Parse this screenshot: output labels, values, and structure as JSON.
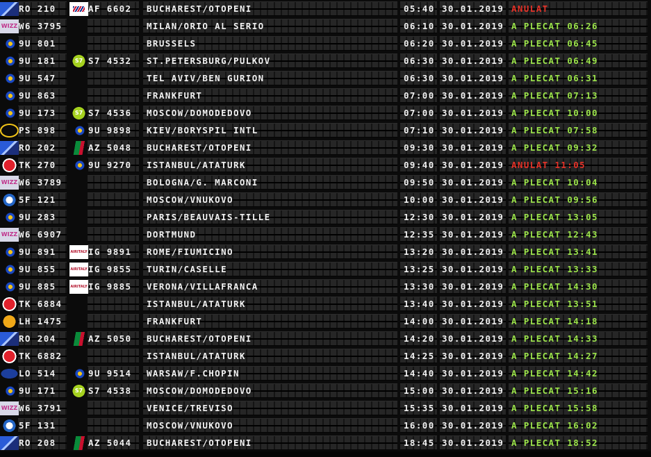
{
  "rows": [
    {
      "flight": "RO 210",
      "logo": "tarom-logo",
      "codeshare_logo": "air-france-logo",
      "codeshare": "AF 6602",
      "destination": "BUCHAREST/OTOPENI",
      "time": "05:40",
      "date": "30.01.2019",
      "status": "ANULAT",
      "status_color": "red"
    },
    {
      "flight": "W6 3795",
      "logo": "wizz-air-logo",
      "codeshare_logo": "",
      "codeshare": "",
      "destination": "MILAN/ORIO AL SERIO",
      "time": "06:10",
      "date": "30.01.2019",
      "status": "A PLECAT 06:26",
      "status_color": "green"
    },
    {
      "flight": "9U 801",
      "logo": "air-moldova-logo",
      "codeshare_logo": "",
      "codeshare": "",
      "destination": "BRUSSELS",
      "time": "06:20",
      "date": "30.01.2019",
      "status": "A PLECAT 06:45",
      "status_color": "green"
    },
    {
      "flight": "9U 181",
      "logo": "air-moldova-logo",
      "codeshare_logo": "s7-logo",
      "codeshare": "S7 4532",
      "destination": "ST.PETERSBURG/PULKOV",
      "time": "06:30",
      "date": "30.01.2019",
      "status": "A PLECAT 06:49",
      "status_color": "green"
    },
    {
      "flight": "9U 547",
      "logo": "air-moldova-logo",
      "codeshare_logo": "",
      "codeshare": "",
      "destination": "TEL AVIV/BEN GURION",
      "time": "06:30",
      "date": "30.01.2019",
      "status": "A PLECAT 06:31",
      "status_color": "green"
    },
    {
      "flight": "9U 863",
      "logo": "air-moldova-logo",
      "codeshare_logo": "",
      "codeshare": "",
      "destination": "FRANKFURT",
      "time": "07:00",
      "date": "30.01.2019",
      "status": "A PLECAT 07:13",
      "status_color": "green"
    },
    {
      "flight": "9U 173",
      "logo": "air-moldova-logo",
      "codeshare_logo": "s7-logo",
      "codeshare": "S7 4536",
      "destination": "MOSCOW/DOMODEDOVO",
      "time": "07:00",
      "date": "30.01.2019",
      "status": "A PLECAT 10:00",
      "status_color": "green"
    },
    {
      "flight": "PS 898",
      "logo": "ukraine-intl-logo",
      "codeshare_logo": "air-moldova-logo",
      "codeshare": "9U 9898",
      "destination": "KIEV/BORYSPIL INTL",
      "time": "07:10",
      "date": "30.01.2019",
      "status": "A PLECAT 07:58",
      "status_color": "green"
    },
    {
      "flight": "RO 202",
      "logo": "tarom-logo",
      "codeshare_logo": "alitalia-logo",
      "codeshare": "AZ 5048",
      "destination": "BUCHAREST/OTOPENI",
      "time": "09:30",
      "date": "30.01.2019",
      "status": "A PLECAT 09:32",
      "status_color": "green"
    },
    {
      "flight": "TK 270",
      "logo": "turkish-airlines-logo",
      "codeshare_logo": "air-moldova-logo",
      "codeshare": "9U 9270",
      "destination": "ISTANBUL/ATATURK",
      "time": "09:40",
      "date": "30.01.2019",
      "status": "ANULAT 11:05",
      "status_color": "red"
    },
    {
      "flight": "W6 3789",
      "logo": "wizz-air-logo",
      "codeshare_logo": "",
      "codeshare": "",
      "destination": "BOLOGNA/G. MARCONI",
      "time": "09:50",
      "date": "30.01.2019",
      "status": "A PLECAT 10:04",
      "status_color": "green"
    },
    {
      "flight": "5F 121",
      "logo": "fly-one-logo",
      "codeshare_logo": "",
      "codeshare": "",
      "destination": "MOSCOW/VNUKOVO",
      "time": "10:00",
      "date": "30.01.2019",
      "status": "A PLECAT 09:56",
      "status_color": "green"
    },
    {
      "flight": "9U 283",
      "logo": "air-moldova-logo",
      "codeshare_logo": "",
      "codeshare": "",
      "destination": "PARIS/BEAUVAIS-TILLE",
      "time": "12:30",
      "date": "30.01.2019",
      "status": "A PLECAT 13:05",
      "status_color": "green"
    },
    {
      "flight": "W6 6907",
      "logo": "wizz-air-logo",
      "codeshare_logo": "",
      "codeshare": "",
      "destination": "DORTMUND",
      "time": "12:35",
      "date": "30.01.2019",
      "status": "A PLECAT 12:43",
      "status_color": "green"
    },
    {
      "flight": "9U 891",
      "logo": "air-moldova-logo",
      "codeshare_logo": "air-italy-logo",
      "codeshare": "IG 9891",
      "destination": "ROME/FIUMICINO",
      "time": "13:20",
      "date": "30.01.2019",
      "status": "A PLECAT 13:41",
      "status_color": "green"
    },
    {
      "flight": "9U 855",
      "logo": "air-moldova-logo",
      "codeshare_logo": "air-italy-logo",
      "codeshare": "IG 9855",
      "destination": "TURIN/CASELLE",
      "time": "13:25",
      "date": "30.01.2019",
      "status": "A PLECAT 13:33",
      "status_color": "green"
    },
    {
      "flight": "9U 885",
      "logo": "air-moldova-logo",
      "codeshare_logo": "air-italy-logo",
      "codeshare": "IG 9885",
      "destination": "VERONA/VILLAFRANCA",
      "time": "13:30",
      "date": "30.01.2019",
      "status": "A PLECAT 14:30",
      "status_color": "green"
    },
    {
      "flight": "TK 6884",
      "logo": "turkish-airlines-logo",
      "codeshare_logo": "",
      "codeshare": "",
      "destination": "ISTANBUL/ATATURK",
      "time": "13:40",
      "date": "30.01.2019",
      "status": "A PLECAT 13:51",
      "status_color": "green"
    },
    {
      "flight": "LH 1475",
      "logo": "lufthansa-logo",
      "codeshare_logo": "",
      "codeshare": "",
      "destination": "FRANKFURT",
      "time": "14:00",
      "date": "30.01.2019",
      "status": "A PLECAT 14:18",
      "status_color": "green"
    },
    {
      "flight": "RO 204",
      "logo": "tarom-logo",
      "codeshare_logo": "alitalia-logo",
      "codeshare": "AZ 5050",
      "destination": "BUCHAREST/OTOPENI",
      "time": "14:20",
      "date": "30.01.2019",
      "status": "A PLECAT 14:33",
      "status_color": "green"
    },
    {
      "flight": "TK 6882",
      "logo": "turkish-airlines-logo",
      "codeshare_logo": "",
      "codeshare": "",
      "destination": "ISTANBUL/ATATURK",
      "time": "14:25",
      "date": "30.01.2019",
      "status": "A PLECAT 14:27",
      "status_color": "green"
    },
    {
      "flight": "LO 514",
      "logo": "lot-logo",
      "codeshare_logo": "air-moldova-logo",
      "codeshare": "9U 9514",
      "destination": "WARSAW/F.CHOPIN",
      "time": "14:40",
      "date": "30.01.2019",
      "status": "A PLECAT 14:42",
      "status_color": "green"
    },
    {
      "flight": "9U 171",
      "logo": "air-moldova-logo",
      "codeshare_logo": "s7-logo",
      "codeshare": "S7 4538",
      "destination": "MOSCOW/DOMODEDOVO",
      "time": "15:00",
      "date": "30.01.2019",
      "status": "A PLECAT 15:16",
      "status_color": "green"
    },
    {
      "flight": "W6 3791",
      "logo": "wizz-air-logo",
      "codeshare_logo": "",
      "codeshare": "",
      "destination": "VENICE/TREVISO",
      "time": "15:35",
      "date": "30.01.2019",
      "status": "A PLECAT 15:58",
      "status_color": "green"
    },
    {
      "flight": "5F 131",
      "logo": "fly-one-logo",
      "codeshare_logo": "",
      "codeshare": "",
      "destination": "MOSCOW/VNUKOVO",
      "time": "16:00",
      "date": "30.01.2019",
      "status": "A PLECAT 16:02",
      "status_color": "green"
    },
    {
      "flight": "RO 208",
      "logo": "tarom-logo",
      "codeshare_logo": "alitalia-logo",
      "codeshare": "AZ 5044",
      "destination": "BUCHAREST/OTOPENI",
      "time": "18:45",
      "date": "30.01.2019",
      "status": "A PLECAT 18:52",
      "status_color": "green"
    }
  ],
  "colors": {
    "text": "#f2f2f2",
    "status_green": "#9be34a",
    "status_red": "#e63228",
    "background": "#060606"
  }
}
